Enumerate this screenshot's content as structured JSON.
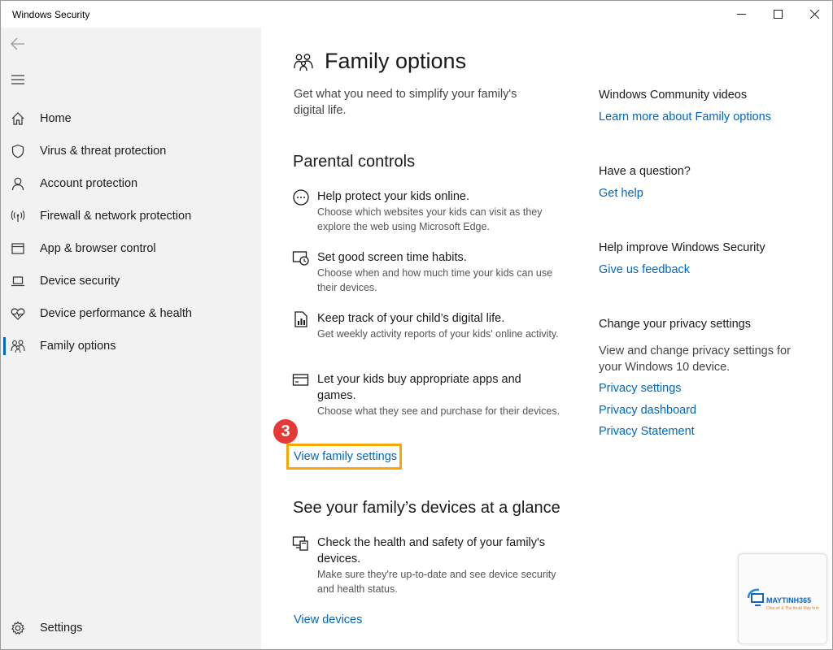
{
  "window": {
    "title": "Windows Security"
  },
  "sidebar": {
    "items": [
      {
        "label": "Home",
        "icon": "home-icon"
      },
      {
        "label": "Virus & threat protection",
        "icon": "shield-icon"
      },
      {
        "label": "Account protection",
        "icon": "person-icon"
      },
      {
        "label": "Firewall & network protection",
        "icon": "antenna-icon"
      },
      {
        "label": "App & browser control",
        "icon": "app-window-icon"
      },
      {
        "label": "Device security",
        "icon": "laptop-icon"
      },
      {
        "label": "Device performance & health",
        "icon": "heart-pulse-icon"
      },
      {
        "label": "Family options",
        "icon": "family-icon",
        "selected": true
      }
    ],
    "settings_label": "Settings"
  },
  "main": {
    "title": "Family options",
    "subtitle": "Get what you need to simplify your family's digital life.",
    "parental": {
      "heading": "Parental controls",
      "features": [
        {
          "title": "Help protect your kids online.",
          "desc": "Choose which websites your kids can visit as they explore the web using Microsoft Edge.",
          "icon": "globe-block-icon"
        },
        {
          "title": "Set good screen time habits.",
          "desc": "Choose when and how much time your kids can use their devices.",
          "icon": "screen-clock-icon"
        },
        {
          "title": "Keep track of your child’s digital life.",
          "desc": "Get weekly activity reports of your kids' online activity.",
          "icon": "report-icon"
        },
        {
          "title": "Let your kids buy appropriate apps and games.",
          "desc": "Choose what they see and purchase for their devices.",
          "icon": "card-icon"
        }
      ],
      "link": "View family settings",
      "step_number": "3"
    },
    "devices": {
      "heading": "See your family’s devices at a glance",
      "feature_title": "Check the health and safety of your family's devices.",
      "feature_desc": "Make sure they're up-to-date and see device security and health status.",
      "link": "View devices"
    }
  },
  "right": {
    "community": {
      "heading": "Windows Community videos",
      "link": "Learn more about Family options"
    },
    "question": {
      "heading": "Have a question?",
      "link": "Get help"
    },
    "improve": {
      "heading": "Help improve Windows Security",
      "link": "Give us feedback"
    },
    "privacy": {
      "heading": "Change your privacy settings",
      "text": "View and change privacy settings for your Windows 10 device.",
      "links": [
        "Privacy settings",
        "Privacy dashboard",
        "Privacy Statement"
      ]
    }
  },
  "watermark": {
    "brand": "MAYTINH365",
    "tagline": "Chia sẻ & Thủ thuật Máy tính"
  },
  "colors": {
    "accent": "#0067c0",
    "highlight": "#f5a800",
    "badge": "#e53935",
    "sidebar_bg": "#f2f2f2"
  }
}
